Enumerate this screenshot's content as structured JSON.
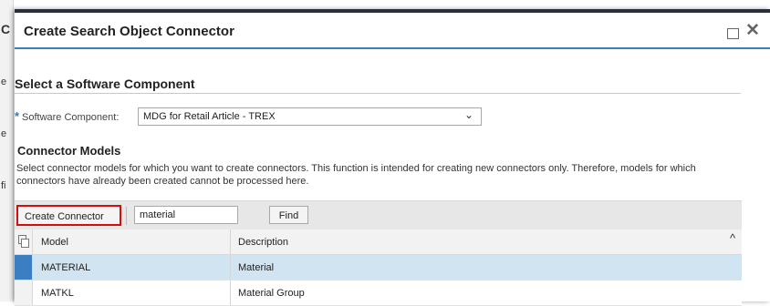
{
  "background": {
    "chars": [
      "C",
      "e",
      "e",
      "fi"
    ]
  },
  "dialog": {
    "title": "Create Search Object Connector",
    "accent_color": "#3f7cb3",
    "header_icons": [
      "maximize-icon",
      "close-icon"
    ]
  },
  "software_component": {
    "section_title": "Select a Software Component",
    "required_marker": "*",
    "label": "Software Component:",
    "selected_value": "MDG for Retail Article - TREX"
  },
  "connector_models": {
    "title": "Connector Models",
    "description": "Select connector models for which you want to create connectors. This function is intended for creating new connectors only. Therefore, models for which connectors have already been created cannot be processed here."
  },
  "toolbar": {
    "create_label": "Create Connector",
    "highlight_color": "#d10f0f",
    "search_value": "material",
    "find_label": "Find"
  },
  "table": {
    "columns": [
      "Model",
      "Description"
    ],
    "rows": [
      {
        "model": "MATERIAL",
        "description": "Material",
        "selected": true
      },
      {
        "model": "MATKL",
        "description": "Material Group",
        "selected": false
      }
    ],
    "selected_row_color": "#d0e4f2"
  }
}
